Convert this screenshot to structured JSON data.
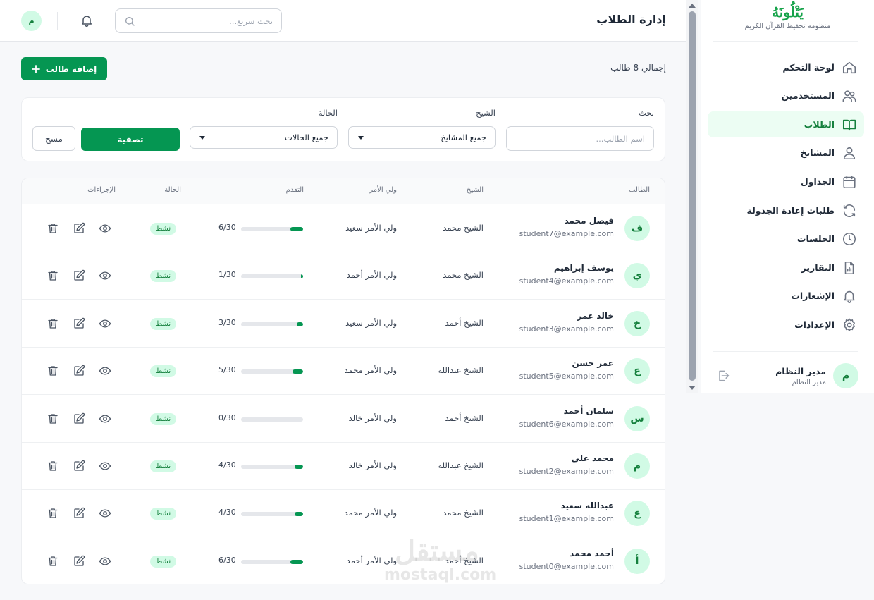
{
  "brand": {
    "name": "يَتْلُونَهُ",
    "subtitle": "منظومة تحفيظ القرآن الكريم"
  },
  "sidebar": {
    "items": [
      {
        "label": "لوحة التحكم",
        "icon": "home-icon",
        "active": false
      },
      {
        "label": "المستخدمين",
        "icon": "users-icon",
        "active": false
      },
      {
        "label": "الطلاب",
        "icon": "book-icon",
        "active": true
      },
      {
        "label": "المشايخ",
        "icon": "user-icon",
        "active": false
      },
      {
        "label": "الجداول",
        "icon": "calendar-icon",
        "active": false
      },
      {
        "label": "طلبات إعادة الجدولة",
        "icon": "refresh-icon",
        "active": false
      },
      {
        "label": "الجلسات",
        "icon": "clock-icon",
        "active": false
      },
      {
        "label": "التقارير",
        "icon": "report-icon",
        "active": false
      },
      {
        "label": "الإشعارات",
        "icon": "bell-icon",
        "active": false
      },
      {
        "label": "الإعدادات",
        "icon": "gear-icon",
        "active": false
      }
    ],
    "profile": {
      "initial": "م",
      "name": "مدير النظام",
      "role": "مدير النظام"
    }
  },
  "header": {
    "title": "إدارة الطلاب",
    "search_placeholder": "بحث سريع...",
    "avatar_initial": "م"
  },
  "toolbar": {
    "total_label": "إجمالي 8 طالب",
    "add_label": "إضافة طالب"
  },
  "filters": {
    "search_label": "بحث",
    "search_placeholder": "اسم الطالب...",
    "sheikh_label": "الشيخ",
    "sheikh_value": "جميع المشايخ",
    "status_label": "الحالة",
    "status_value": "جميع الحالات",
    "filter_button": "تصفية",
    "clear_button": "مسح"
  },
  "table": {
    "columns": {
      "student": "الطالب",
      "sheikh": "الشيخ",
      "guardian": "ولي الأمر",
      "progress": "التقدم",
      "status": "الحالة",
      "actions": "الإجراءات"
    },
    "rows": [
      {
        "initial": "ف",
        "name": "فيصل محمد",
        "email": "student7@example.com",
        "sheikh": "الشيخ محمد",
        "guardian": "ولي الأمر سعيد",
        "progress": "6/30",
        "progress_value": 0.2,
        "status": "نشط"
      },
      {
        "initial": "ي",
        "name": "يوسف إبراهيم",
        "email": "student4@example.com",
        "sheikh": "الشيخ محمد",
        "guardian": "ولي الأمر أحمد",
        "progress": "1/30",
        "progress_value": 0.033,
        "status": "نشط"
      },
      {
        "initial": "خ",
        "name": "خالد عمر",
        "email": "student3@example.com",
        "sheikh": "الشيخ أحمد",
        "guardian": "ولي الأمر سعيد",
        "progress": "3/30",
        "progress_value": 0.1,
        "status": "نشط"
      },
      {
        "initial": "ع",
        "name": "عمر حسن",
        "email": "student5@example.com",
        "sheikh": "الشيخ عبدالله",
        "guardian": "ولي الأمر محمد",
        "progress": "5/30",
        "progress_value": 0.167,
        "status": "نشط"
      },
      {
        "initial": "س",
        "name": "سلمان أحمد",
        "email": "student6@example.com",
        "sheikh": "الشيخ أحمد",
        "guardian": "ولي الأمر خالد",
        "progress": "0/30",
        "progress_value": 0,
        "status": "نشط"
      },
      {
        "initial": "م",
        "name": "محمد علي",
        "email": "student2@example.com",
        "sheikh": "الشيخ عبدالله",
        "guardian": "ولي الأمر خالد",
        "progress": "4/30",
        "progress_value": 0.133,
        "status": "نشط"
      },
      {
        "initial": "ع",
        "name": "عبدالله سعيد",
        "email": "student1@example.com",
        "sheikh": "الشيخ محمد",
        "guardian": "ولي الأمر محمد",
        "progress": "4/30",
        "progress_value": 0.133,
        "status": "نشط"
      },
      {
        "initial": "أ",
        "name": "أحمد محمد",
        "email": "student0@example.com",
        "sheikh": "الشيخ أحمد",
        "guardian": "ولي الأمر أحمد",
        "progress": "6/30",
        "progress_value": 0.2,
        "status": "نشط"
      }
    ]
  },
  "watermark": {
    "arabic": "مستقل",
    "latin": "mostaql.com"
  },
  "colors": {
    "primary": "#059652",
    "primary_light": "#d1fae5",
    "primary_text": "#15803d"
  }
}
